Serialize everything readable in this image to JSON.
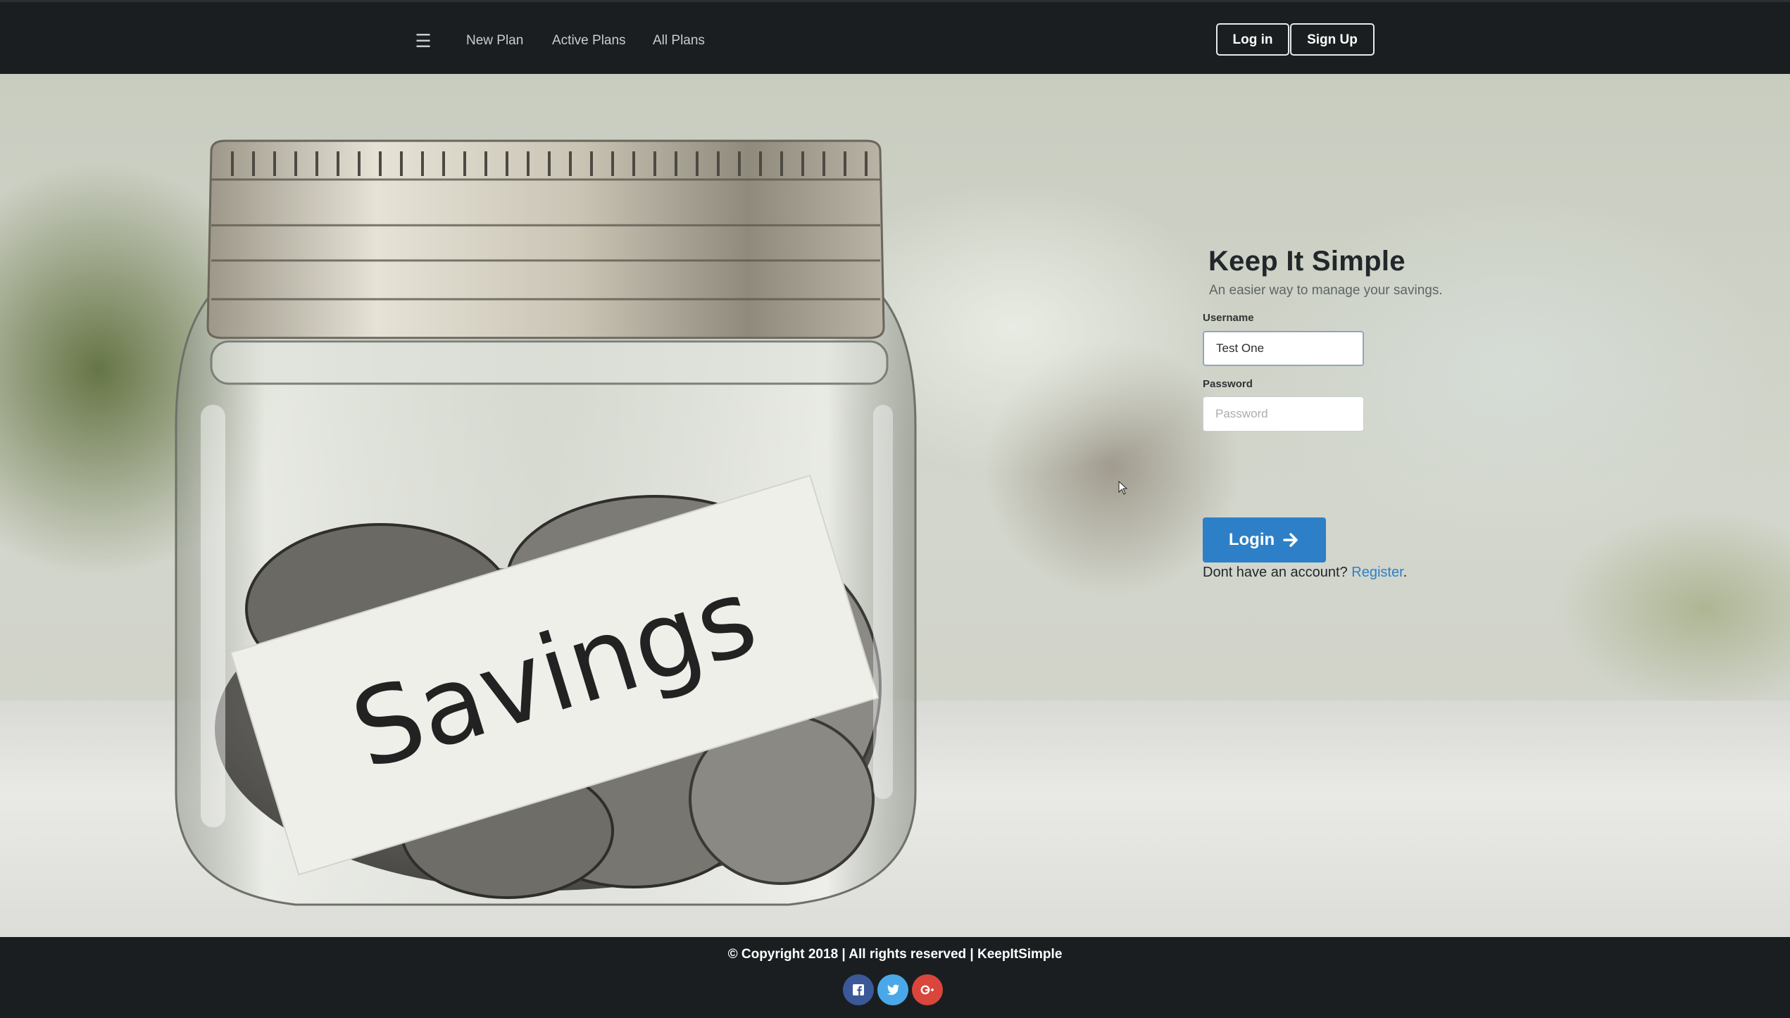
{
  "navbar": {
    "menu_icon": "hamburger-icon",
    "links": [
      "New Plan",
      "Active Plans",
      "All Plans"
    ],
    "login_label": "Log in",
    "signup_label": "Sign Up"
  },
  "hero": {
    "jar_label_text": "Savings"
  },
  "login_form": {
    "title": "Keep It Simple",
    "subtitle": "An easier way to manage your savings.",
    "username_label": "Username",
    "username_value": "Test One",
    "password_label": "Password",
    "password_placeholder": "Password",
    "submit_label": "Login",
    "submit_icon": "arrow-right-icon",
    "register_prompt": "Dont have an account?",
    "register_link": "Register",
    "register_period": "."
  },
  "footer": {
    "copyright": "© Copyright 2018 | All rights reserved | KeepItSimple",
    "social": [
      {
        "icon": "facebook-icon",
        "color": "#3b5998"
      },
      {
        "icon": "twitter-icon",
        "color": "#4aa8e8"
      },
      {
        "icon": "google-plus-icon",
        "color": "#d9463b"
      }
    ]
  },
  "colors": {
    "navbar_bg": "#1a1e20",
    "accent": "#2d80c7"
  }
}
